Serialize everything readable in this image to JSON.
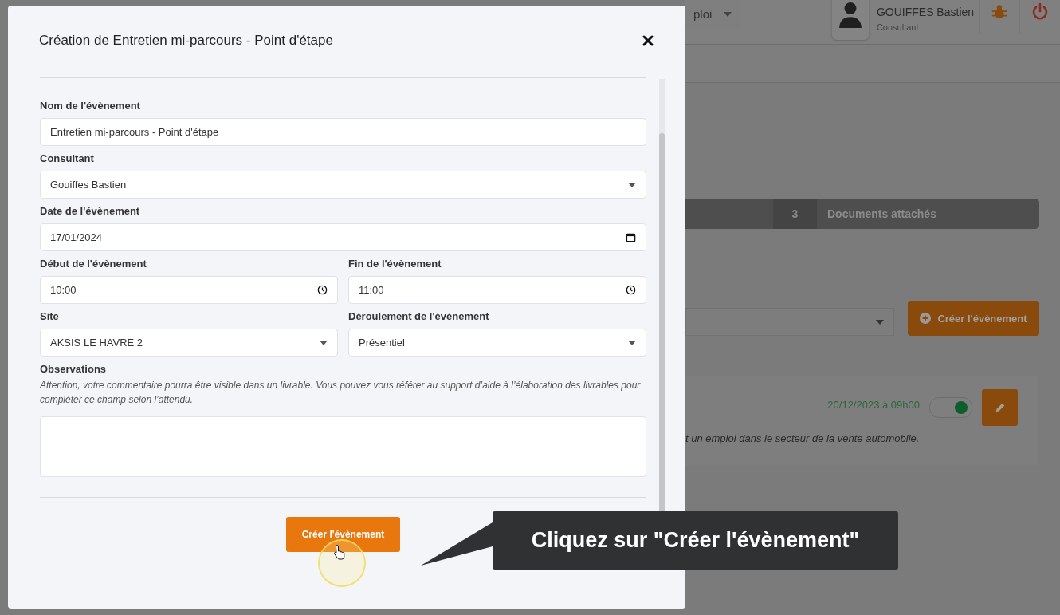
{
  "background_page": {
    "header": {
      "dropdown_value": "ploi",
      "user_name": "GOUIFFES Bastien",
      "user_role": "Consultant"
    },
    "tabs": [
      {
        "number": "3",
        "label": "Documents attachés",
        "selected": false
      }
    ],
    "create_button": "Créer l'évènement",
    "event": {
      "date": "20/12/2023 à 09h00",
      "on": true,
      "description": "t un emploi dans le secteur de la vente automobile."
    }
  },
  "modal": {
    "title": "Création de Entretien mi-parcours - Point d'étape",
    "field_rows": [
      [
        {
          "label": "Nom de l'évènement",
          "kind": "text",
          "value": "Entretien mi-parcours - Point d'étape"
        }
      ],
      [
        {
          "label": "Consultant",
          "kind": "select",
          "value": "Gouiffes Bastien"
        }
      ],
      [
        {
          "label": "Date de l'évènement",
          "kind": "date",
          "value": "17/01/2024"
        }
      ],
      [
        {
          "label": "Début de l'évènement",
          "kind": "time",
          "value": "10:00"
        },
        {
          "label": "Fin de l'évènement",
          "kind": "time",
          "value": "11:00"
        }
      ],
      [
        {
          "label": "Site",
          "kind": "select",
          "value": "AKSIS LE HAVRE 2"
        },
        {
          "label": "Déroulement de l'évènement",
          "kind": "select",
          "value": "Présentiel"
        }
      ]
    ],
    "observations": {
      "label": "Observations",
      "hint": "Attention, votre commentaire pourra être visible dans un livrable. Vous pouvez vous référer au support d’aide à l’élaboration des livrables pour compléter ce champ selon l’attendu."
    },
    "submit_button": "Créer l'évènement"
  },
  "tooltip": {
    "text": "Cliquez sur \"Créer l'évènement\""
  }
}
